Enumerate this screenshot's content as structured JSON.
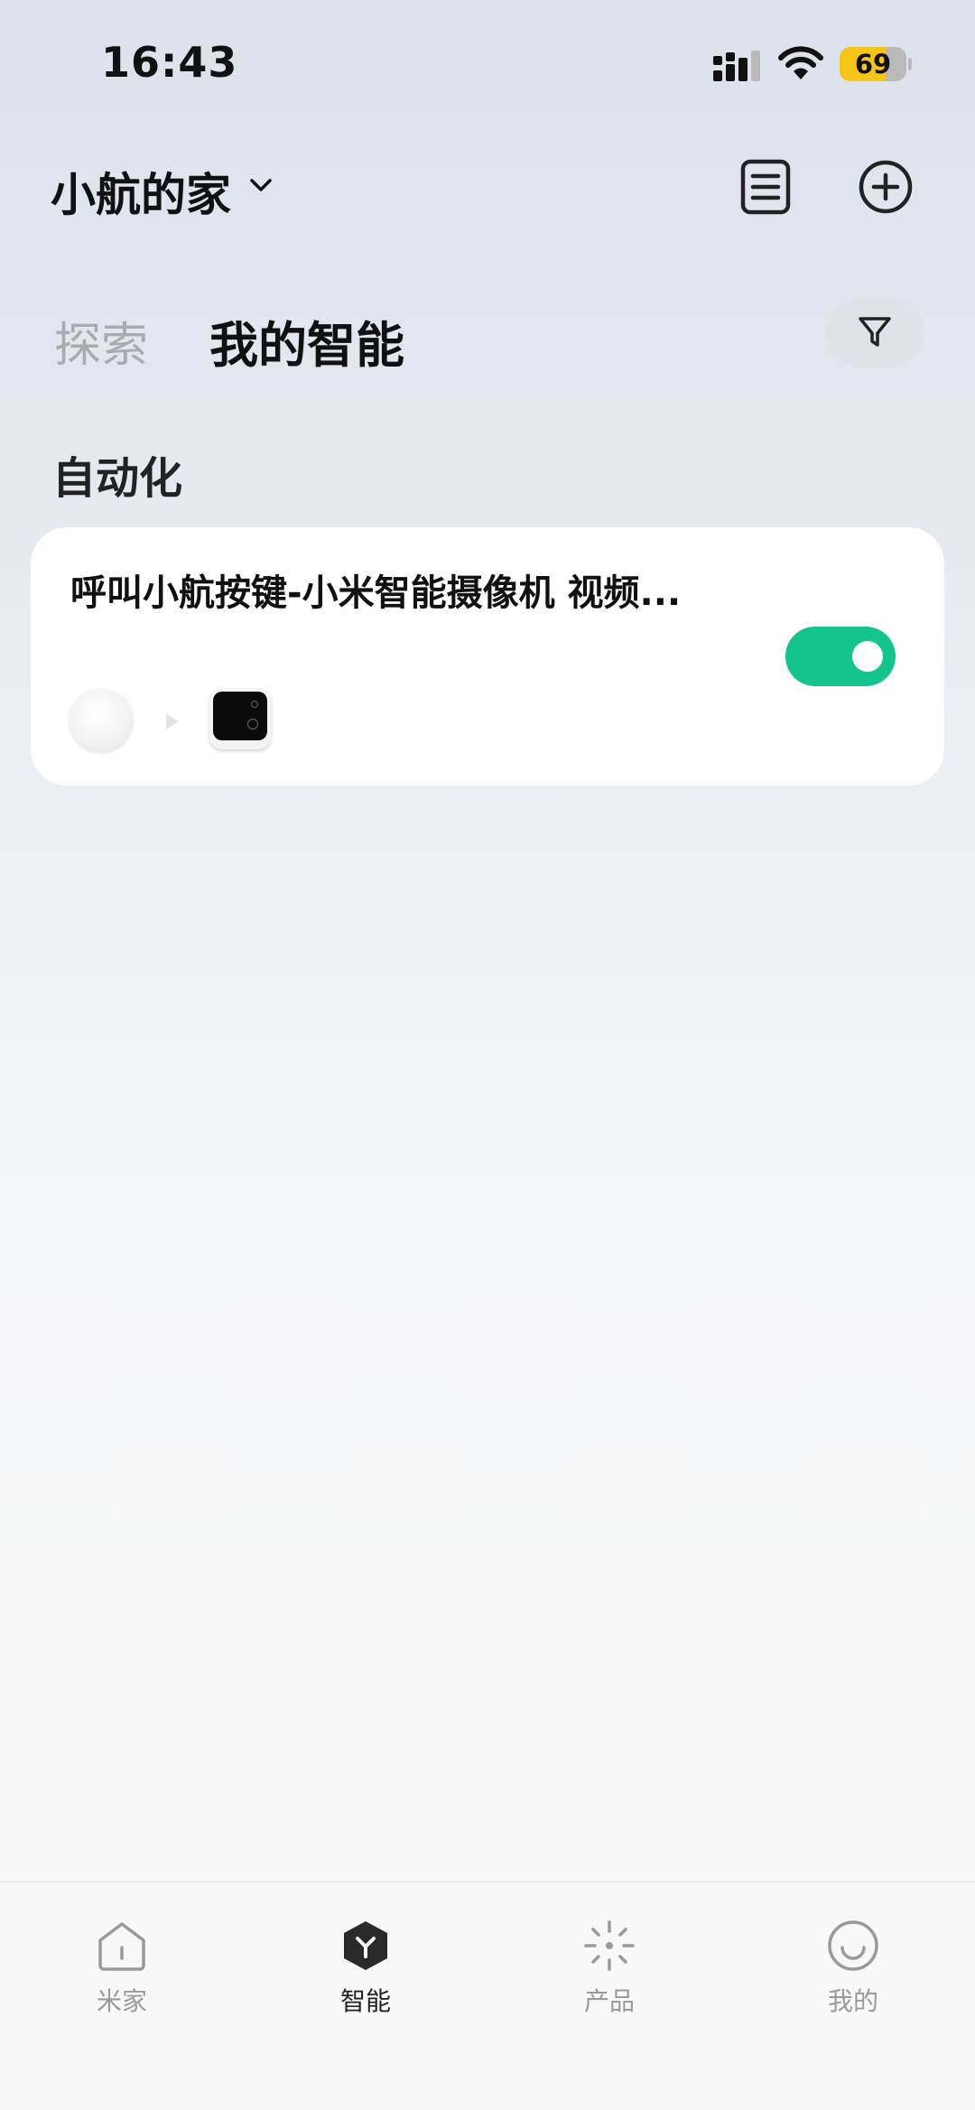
{
  "status_bar": {
    "time": "16:43",
    "battery_level": "69",
    "battery_fraction": 0.69,
    "icons": [
      "cellular-signal-icon",
      "wifi-icon",
      "battery-icon"
    ]
  },
  "header": {
    "home_name": "小航的家",
    "icons": [
      "chevron-down-icon",
      "scene-log-icon",
      "add-circle-icon"
    ]
  },
  "tabs": {
    "explore": "探索",
    "mine": "我的智能",
    "active": "mine",
    "filter_icon": "filter-icon"
  },
  "section": {
    "title": "自动化"
  },
  "automations": [
    {
      "title": "呼叫小航按键-小米智能摄像机 视频...",
      "enabled": true,
      "trigger_device": "wireless-button",
      "action_device": "smart-camera"
    }
  ],
  "bottom_nav": {
    "items": [
      {
        "label": "米家",
        "icon": "home-icon",
        "active": false
      },
      {
        "label": "智能",
        "icon": "smart-hexagon-icon",
        "active": true
      },
      {
        "label": "产品",
        "icon": "product-sparkle-icon",
        "active": false
      },
      {
        "label": "我的",
        "icon": "smiley-icon",
        "active": false
      }
    ]
  },
  "colors": {
    "accent_green": "#13c48c",
    "inactive_text": "#9a9a9a",
    "battery_yellow": "#f5c518"
  }
}
